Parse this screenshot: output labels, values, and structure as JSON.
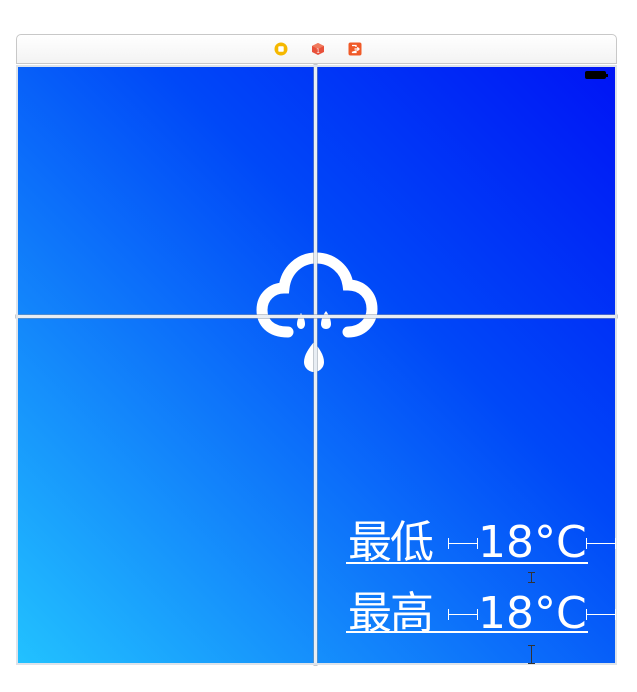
{
  "scene_dock": {
    "icons": [
      "view-controller-icon",
      "first-responder-icon",
      "exit-icon"
    ]
  },
  "status_bar": {
    "battery": "battery-icon"
  },
  "weather": {
    "icon": "cloud-rain-icon",
    "low_label": "最低",
    "low_value": "18°C",
    "high_label": "最高",
    "high_value": "18°C"
  },
  "colors": {
    "gradient_top_right": "#0014f5",
    "gradient_bottom_left": "#22c2ff",
    "view_controller_icon": "#f5b800",
    "first_responder_icon": "#e8503a",
    "exit_icon": "#f05a28"
  }
}
